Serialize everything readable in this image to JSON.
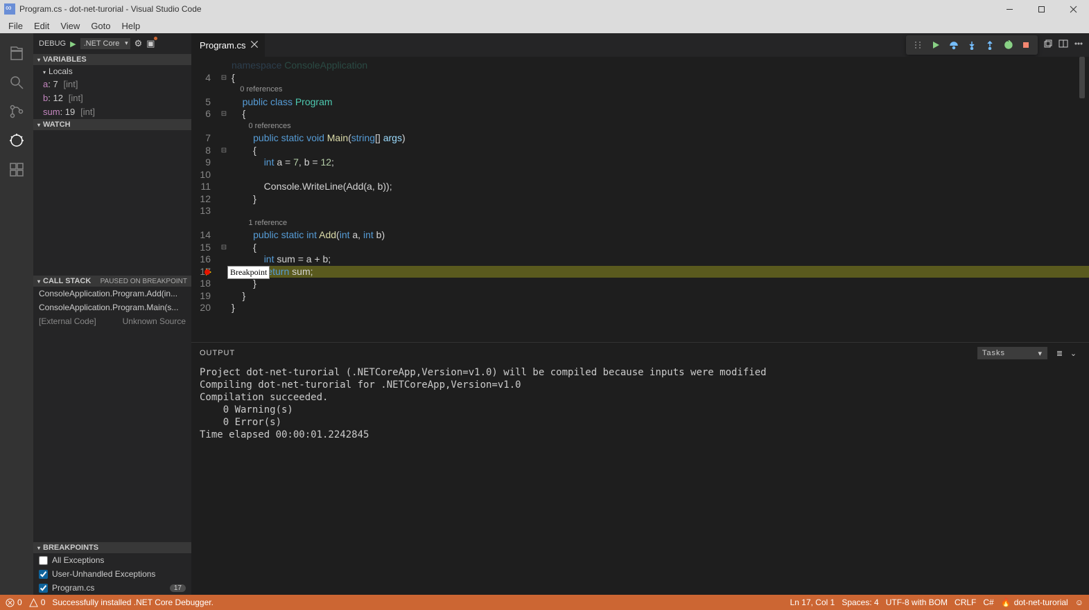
{
  "window": {
    "title": "Program.cs - dot-net-turorial - Visual Studio Code"
  },
  "menu": [
    "File",
    "Edit",
    "View",
    "Goto",
    "Help"
  ],
  "debug": {
    "label": "DEBUG",
    "config": ".NET Core"
  },
  "sidebar": {
    "variables": {
      "title": "VARIABLES",
      "locals_label": "Locals",
      "vars": [
        {
          "name": "a",
          "value": "7",
          "type": "[int]"
        },
        {
          "name": "b",
          "value": "12",
          "type": "[int]"
        },
        {
          "name": "sum",
          "value": "19",
          "type": "[int]"
        }
      ]
    },
    "watch": {
      "title": "WATCH"
    },
    "callstack": {
      "title": "CALL STACK",
      "status": "PAUSED ON BREAKPOINT",
      "frames": [
        "ConsoleApplication.Program.Add(in...",
        "ConsoleApplication.Program.Main(s..."
      ],
      "external": {
        "label": "[External Code]",
        "source": "Unknown Source"
      }
    },
    "breakpoints": {
      "title": "BREAKPOINTS",
      "items": [
        {
          "checked": false,
          "label": "All Exceptions"
        },
        {
          "checked": true,
          "label": "User-Unhandled Exceptions"
        },
        {
          "checked": true,
          "label": "Program.cs",
          "count": "17"
        }
      ]
    }
  },
  "tabs": [
    {
      "label": "Program.cs"
    }
  ],
  "editor": {
    "breakpoint_tooltip": "Breakpoint",
    "lines": {
      "3": "namespace ConsoleApplication",
      "4": "{",
      "cl1": "    0 references",
      "5": "    public class Program",
      "6": "    {",
      "cl2": "        0 references",
      "7": "        public static void Main(string[] args)",
      "8": "        {",
      "9": "            int a = 7, b = 12;",
      "10": "",
      "11": "            Console.WriteLine(Add(a, b));",
      "12": "        }",
      "13": "",
      "cl3": "        1 reference",
      "14": "        public static int Add(int a, int b)",
      "15": "        {",
      "16": "            int sum = a + b;",
      "17": "            return sum;",
      "18": "        }",
      "19": "    }",
      "20": "}"
    }
  },
  "output": {
    "title": "OUTPUT",
    "select": "Tasks",
    "text": "Project dot-net-turorial (.NETCoreApp,Version=v1.0) will be compiled because inputs were modified\nCompiling dot-net-turorial for .NETCoreApp,Version=v1.0\nCompilation succeeded.\n    0 Warning(s)\n    0 Error(s)\nTime elapsed 00:00:01.2242845"
  },
  "status": {
    "errors": "0",
    "warnings": "0",
    "message": "Successfully installed .NET Core Debugger.",
    "ln": "Ln 17, Col 1",
    "spaces": "Spaces: 4",
    "encoding": "UTF-8 with BOM",
    "eol": "CRLF",
    "lang": "C#",
    "project": "dot-net-turorial"
  }
}
